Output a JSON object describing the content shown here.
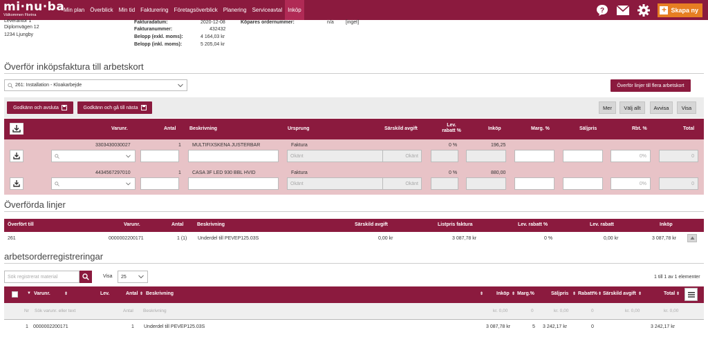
{
  "nav": {
    "brand": "mi·nu·ba",
    "welcome": "Välkommen Florina",
    "items": [
      "Min plan",
      "Överblick",
      "Min tid",
      "Fakturering",
      "Företagsöverblick",
      "Planering",
      "Serviceavtal",
      "Inköp"
    ],
    "active": "Inköp",
    "create_label": "Skapa ny"
  },
  "supplier": {
    "label": "Leverantör 1",
    "street": "Diplomvägen 12",
    "city": "1234 Ljungby"
  },
  "invoice": {
    "date_label": "Fakturadatum:",
    "date_value": "2020-12-08",
    "number_label": "Fakturanummer:",
    "number_value": "432432",
    "excl_label": "Belopp (exkl. moms):",
    "excl_value": "4 164,03 kr",
    "incl_label": "Belopp (inkl. moms):",
    "incl_value": "5 205,04 kr",
    "buyer_order_label": "Köpares ordernummer:",
    "buyer_order_value": "n/a",
    "buyer_order_extra": "[inget]"
  },
  "transfer": {
    "title": "Överför inköpsfaktura till arbetskort",
    "job_select": "261: Installation - Kloakarbejde",
    "multi_button": "Överför linjer till flera arbetskort",
    "approve_close": "Godkänn och avsluta",
    "approve_next": "Godkänn och gå till nästa",
    "more": "Mer",
    "choose_all": "Välj allt",
    "reject": "Avvisa",
    "show": "Visa"
  },
  "main_table": {
    "headers": {
      "varunr": "Varunr.",
      "antal": "Antal",
      "beskrivning": "Beskrivning",
      "ursprung": "Ursprung",
      "sarskild": "Särskild avgift",
      "lev_rabatt": "Lev. rabatt %",
      "inkop": "Inköp",
      "marg": "Marg. %",
      "saljpris": "Säljpris",
      "rbt": "Rbt. %",
      "total": "Total"
    },
    "rows": [
      {
        "varunr": "3303430030027",
        "antal": "1",
        "beskrivning": "MULTIFIXSKENA JUSTERBAR",
        "ursprung": "Faktura",
        "lev_rabatt": "0 %",
        "inkop": "196,25",
        "placeholder": "Okänt",
        "rbt": "0%",
        "total": "0"
      },
      {
        "varunr": "4434567297010",
        "antal": "1",
        "beskrivning": "CASA 3F LED 930 BBL HVID",
        "ursprung": "Faktura",
        "lev_rabatt": "0 %",
        "inkop": "880,00",
        "placeholder": "Okänt",
        "rbt": "0%",
        "total": "0"
      }
    ]
  },
  "transferred": {
    "title": "Överförda linjer",
    "headers": {
      "till": "Överfört till",
      "varunr": "Varunr.",
      "antal": "Antal",
      "beskrivning": "Beskrivning",
      "sarskild": "Särskild avgift",
      "listpris": "Listpris faktura",
      "lev_rabatt_pct": "Lev. rabatt %",
      "lev_rabatt": "Lev. rabatt",
      "inkop": "Inköp"
    },
    "row": {
      "till": "261",
      "varunr": "0000002200171",
      "antal": "1 (1)",
      "beskrivning": "Underdel till PEVEP125.03S",
      "sarskild": "0,00 kr",
      "listpris": "3 087,78 kr",
      "lev_rabatt_pct": "0 %",
      "lev_rabatt": "0,00 kr",
      "inkop": "3 087,78 kr"
    }
  },
  "registrations": {
    "title": "arbetsorderregistreringar",
    "search_placeholder": "Sök registrerat material",
    "show_label": "Visa",
    "page_size": "25",
    "paging": "1 till 1 av 1 elementer",
    "headers": {
      "varunr": "Varunr.",
      "lev": "Lev.",
      "antal": "Antal",
      "beskrivning": "Beskrivning",
      "inkop": "Inköp",
      "marg": "Marg.%",
      "saljpris": "Säljpris",
      "rabatt": "Rabatt%",
      "sarskild": "Särskild avgift",
      "total": "Total"
    },
    "filter": {
      "nr": "Nr",
      "varunr": "Sök varunr. eller text",
      "antal": "Antal",
      "beskrivning": "Beskrivning",
      "inkop": "kr. 0,00",
      "marg": "0",
      "saljpris": "kr. 0,00",
      "rabatt": "0",
      "sarskild": "kr. 0,00",
      "total": "kr. 0,00"
    },
    "row": {
      "nr": "1",
      "varunr": "0000002200171",
      "antal": "1",
      "beskrivning": "Underdel till PEVEP125.03S",
      "inkop": "3 087,78 kr",
      "marg": "5",
      "saljpris": "3 242,17 kr",
      "rabatt": "0",
      "total": "3 242,17 kr"
    }
  }
}
